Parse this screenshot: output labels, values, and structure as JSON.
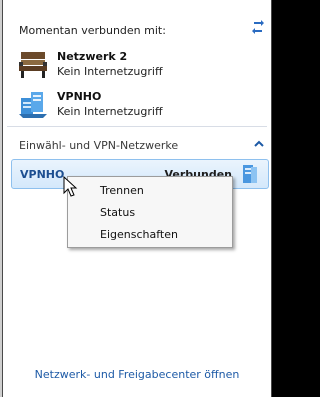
{
  "header": {
    "title": "Momentan verbunden mit:"
  },
  "connected": [
    {
      "name": "Netzwerk  2",
      "status": "Kein Internetzugriff",
      "icon": "bench-network-icon"
    },
    {
      "name": "VPNHO",
      "status": "Kein Internetzugriff",
      "icon": "vpn-network-icon"
    }
  ],
  "section": {
    "title": "Einwähl- und VPN-Netzwerke"
  },
  "vpn_item": {
    "name": "VPNHO",
    "status": "Verbunden"
  },
  "context_menu": {
    "items": [
      "Trennen",
      "Status",
      "Eigenschaften"
    ]
  },
  "footer": {
    "link": "Netzwerk- und Freigabecenter öffnen"
  },
  "colors": {
    "accent": "#1d5aa6",
    "selected_bg": "#d4e8fb",
    "selected_border": "#8ec0ee"
  }
}
